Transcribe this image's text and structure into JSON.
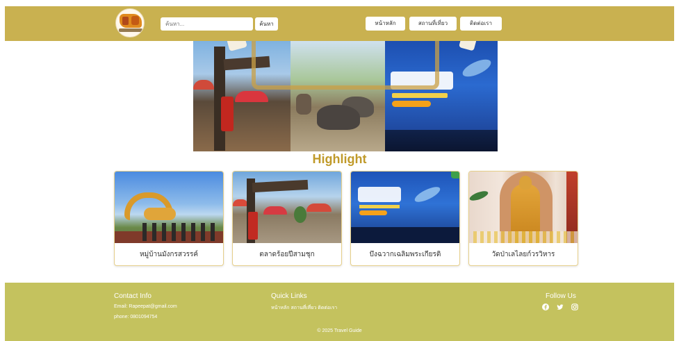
{
  "header": {
    "logo_name": "logo-icon",
    "search": {
      "placeholder": "ค้นหา...",
      "button_label": "ค้นหา"
    },
    "nav": [
      {
        "label": "หน้าหลัก"
      },
      {
        "label": "สถานที่เที่ยว"
      },
      {
        "label": "ติดต่อเรา"
      }
    ]
  },
  "hero": {},
  "highlight": {
    "title": "Highlight",
    "cards": [
      {
        "label": "หมู่บ้านมังกรสวรรค์"
      },
      {
        "label": "ตลาดร้อยปีสามชุก"
      },
      {
        "label": "บึงฉวากเฉลิมพระเกียรติ"
      },
      {
        "label": "วัดป่าเลไลยก์วรวิหาร"
      }
    ]
  },
  "footer": {
    "contact": {
      "heading": "Contact Info",
      "email": "Email: Rapeepat@gmail.com",
      "phone": "phone: 0801094754"
    },
    "quick_links": {
      "heading": "Quick Links",
      "links": [
        "หน้าหลัก",
        "สถานที่เที่ยว",
        "ติดต่อเรา"
      ]
    },
    "follow": {
      "heading": "Follow Us",
      "icons": [
        "facebook-icon",
        "twitter-icon",
        "instagram-icon"
      ]
    },
    "copyright": "© 2025 Travel Guide"
  },
  "colors": {
    "header_bg": "#c9b150",
    "footer_bg": "#c4c25e",
    "highlight_title": "#c09a2a",
    "card_border": "#e6cf8a"
  }
}
